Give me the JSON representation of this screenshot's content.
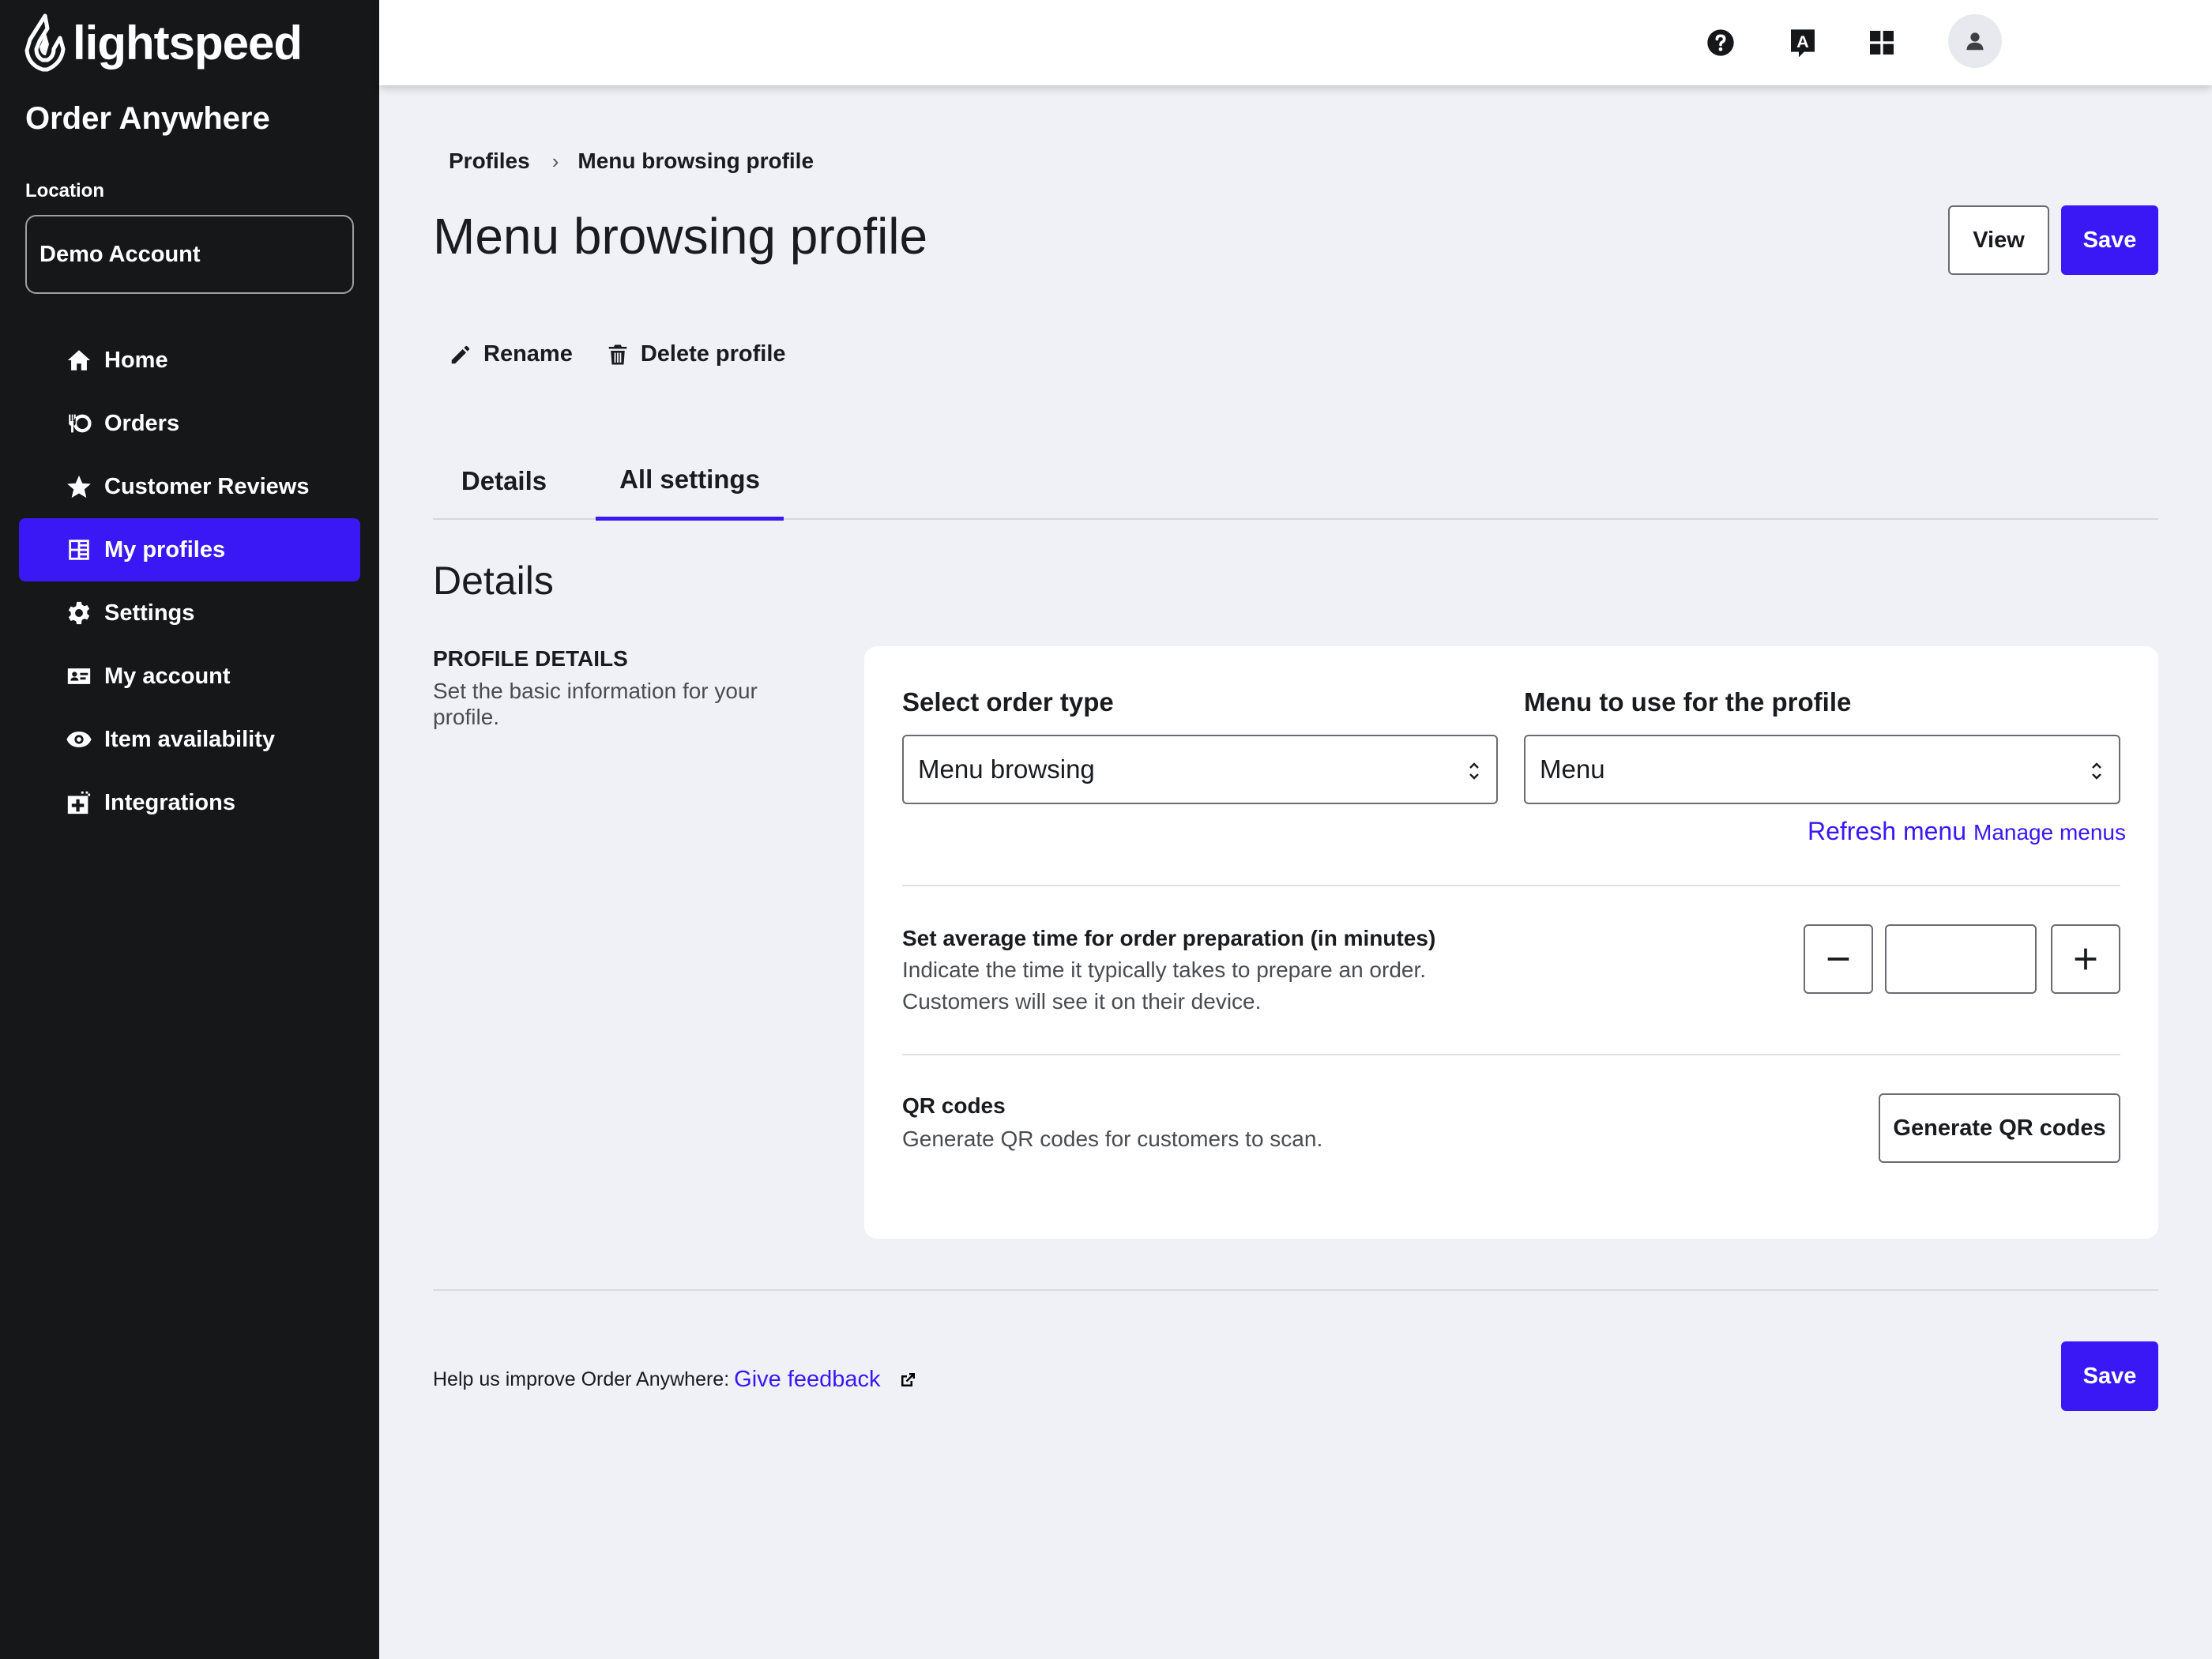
{
  "brand": {
    "logo_text": "lightspeed",
    "app_title": "Order Anywhere",
    "accent": "#3a17f5"
  },
  "sidebar": {
    "location_label": "Location",
    "location_value": "Demo Account",
    "items": [
      {
        "label": "Home",
        "icon": "home-icon"
      },
      {
        "label": "Orders",
        "icon": "orders-icon"
      },
      {
        "label": "Customer Reviews",
        "icon": "star-icon"
      },
      {
        "label": "My profiles",
        "icon": "profiles-icon",
        "active": true
      },
      {
        "label": "Settings",
        "icon": "gear-icon"
      },
      {
        "label": "My account",
        "icon": "account-card-icon"
      },
      {
        "label": "Item availability",
        "icon": "eye-icon"
      },
      {
        "label": "Integrations",
        "icon": "integrations-icon"
      }
    ]
  },
  "topbar": {
    "icons": [
      "help-icon",
      "language-icon",
      "apps-grid-icon",
      "user-avatar-icon"
    ],
    "language_glyph": "A"
  },
  "breadcrumb": {
    "parent": "Profiles",
    "current": "Menu browsing profile"
  },
  "page": {
    "title": "Menu browsing profile",
    "view_label": "View",
    "save_label": "Save",
    "rename_label": "Rename",
    "delete_label": "Delete profile"
  },
  "tabs": [
    {
      "label": "Details",
      "active": false
    },
    {
      "label": "All settings",
      "active": true
    }
  ],
  "details": {
    "section_title": "Details",
    "profile_details_title": "PROFILE DETAILS",
    "profile_details_desc": "Set the basic information for your profile.",
    "order_type_label": "Select order type",
    "order_type_value": "Menu browsing",
    "menu_label": "Menu to use for the profile",
    "menu_value": "Menu",
    "refresh_menu": "Refresh menu",
    "manage_menus": "Manage menus",
    "prep_title": "Set average time for order preparation (in minutes)",
    "prep_desc_1": "Indicate the time it typically takes to prepare an order.",
    "prep_desc_2": "Customers will see it on their device.",
    "prep_value": "",
    "qr_title": "QR codes",
    "qr_desc": "Generate QR codes for customers to scan.",
    "qr_button": "Generate QR codes"
  },
  "footer": {
    "feedback_prefix": "Help us improve Order Anywhere:",
    "feedback_link": "Give feedback",
    "save_label": "Save"
  }
}
